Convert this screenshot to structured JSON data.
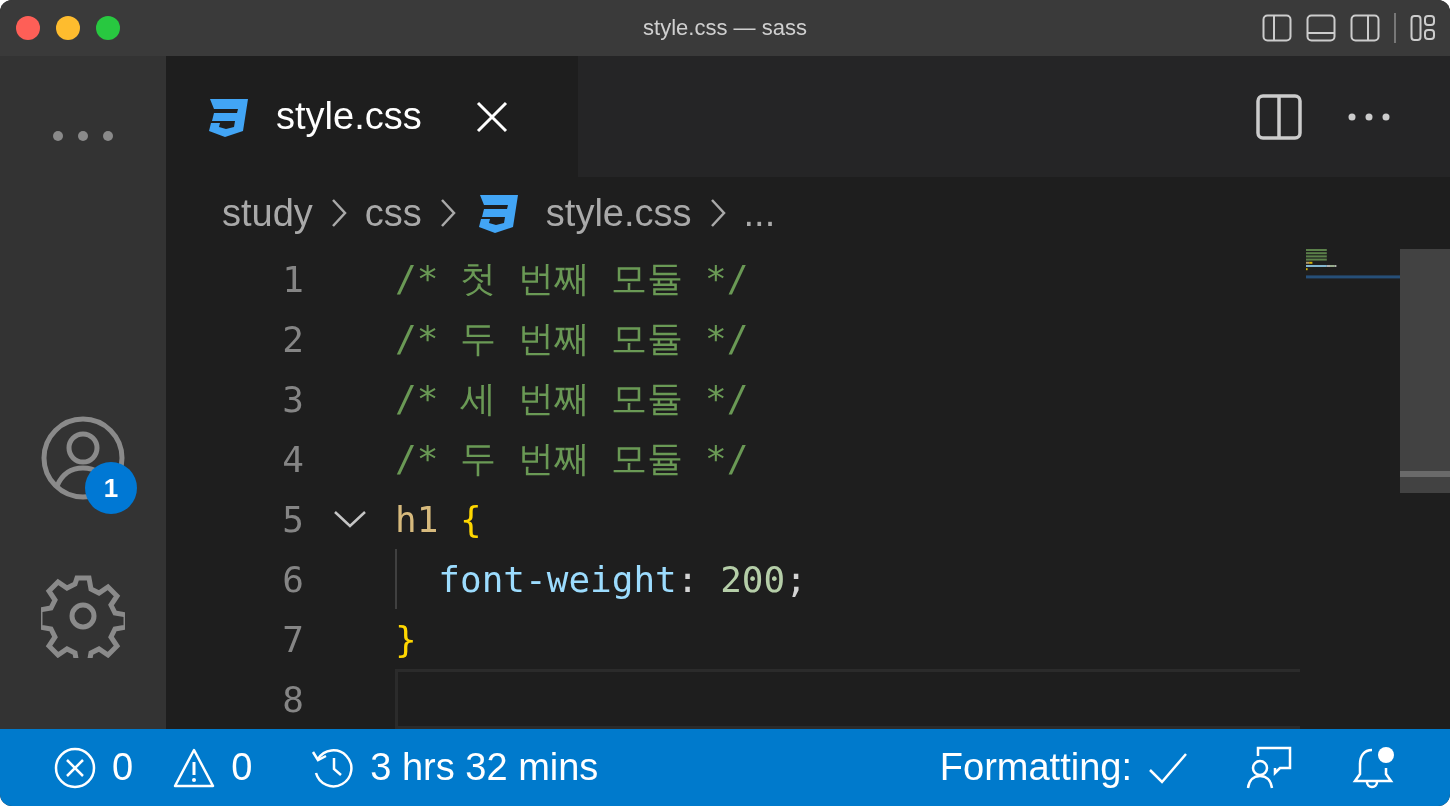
{
  "window": {
    "title": "style.css — sass"
  },
  "activity_bar": {
    "account_badge": "1"
  },
  "tabs": [
    {
      "label": "style.css",
      "selected": true
    }
  ],
  "breadcrumbs": [
    {
      "kind": "folder",
      "label": "study"
    },
    {
      "kind": "folder",
      "label": "css"
    },
    {
      "kind": "file",
      "label": "style.css"
    },
    {
      "kind": "more",
      "label": "..."
    }
  ],
  "editor": {
    "lines": [
      {
        "number": "1",
        "foldable": false,
        "indent_guide": false,
        "current": false,
        "tokens": [
          {
            "kind": "comment",
            "text": "/* 첫 번째 모듈 */"
          }
        ]
      },
      {
        "number": "2",
        "foldable": false,
        "indent_guide": false,
        "current": false,
        "tokens": [
          {
            "kind": "comment",
            "text": "/* 두 번째 모듈 */"
          }
        ]
      },
      {
        "number": "3",
        "foldable": false,
        "indent_guide": false,
        "current": false,
        "tokens": [
          {
            "kind": "comment",
            "text": "/* 세 번째 모듈 */"
          }
        ]
      },
      {
        "number": "4",
        "foldable": false,
        "indent_guide": false,
        "current": false,
        "tokens": [
          {
            "kind": "comment",
            "text": "/* 두 번째 모듈 */"
          }
        ]
      },
      {
        "number": "5",
        "foldable": true,
        "indent_guide": false,
        "current": false,
        "tokens": [
          {
            "kind": "selector",
            "text": "h1"
          },
          {
            "kind": "brace",
            "text": " {"
          }
        ]
      },
      {
        "number": "6",
        "foldable": false,
        "indent_guide": true,
        "current": false,
        "tokens": [
          {
            "kind": "property",
            "text": "  font-weight"
          },
          {
            "kind": "punct",
            "text": ": "
          },
          {
            "kind": "number",
            "text": "200"
          },
          {
            "kind": "punct",
            "text": ";"
          }
        ]
      },
      {
        "number": "7",
        "foldable": false,
        "indent_guide": false,
        "current": false,
        "tokens": [
          {
            "kind": "brace",
            "text": "}"
          }
        ]
      },
      {
        "number": "8",
        "foldable": false,
        "indent_guide": false,
        "current": true
      }
    ]
  },
  "status_bar": {
    "errors": "0",
    "warnings": "0",
    "time": "3 hrs 32 mins",
    "formatting": "Formatting:"
  }
}
